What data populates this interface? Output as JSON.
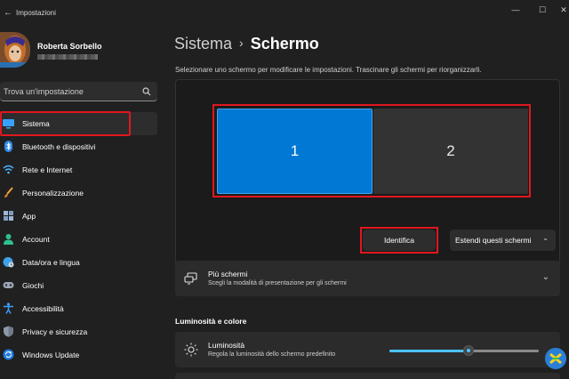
{
  "window": {
    "app_title": "Impostazioni",
    "controls": {
      "minimize": "—",
      "maximize": "☐",
      "close": "✕"
    }
  },
  "user": {
    "name": "Roberta Sorbello"
  },
  "search": {
    "placeholder": "Trova un'impostazione",
    "icon": "search-icon"
  },
  "sidebar": {
    "items": [
      {
        "label": "Sistema",
        "icon": "system-icon",
        "active": true
      },
      {
        "label": "Bluetooth e dispositivi",
        "icon": "bluetooth-icon"
      },
      {
        "label": "Rete e Internet",
        "icon": "wifi-icon"
      },
      {
        "label": "Personalizzazione",
        "icon": "brush-icon"
      },
      {
        "label": "App",
        "icon": "apps-icon"
      },
      {
        "label": "Account",
        "icon": "person-icon"
      },
      {
        "label": "Data/ora e lingua",
        "icon": "globe-clock-icon"
      },
      {
        "label": "Giochi",
        "icon": "gamepad-icon"
      },
      {
        "label": "Accessibilità",
        "icon": "accessibility-icon"
      },
      {
        "label": "Privacy e sicurezza",
        "icon": "shield-icon"
      },
      {
        "label": "Windows Update",
        "icon": "update-icon"
      }
    ]
  },
  "main": {
    "breadcrumb": {
      "parent": "Sistema",
      "separator": "›",
      "current": "Schermo"
    },
    "hint": "Selezionare uno schermo per modificare le impostazioni. Trascinare gli schermi per riorganizzarli.",
    "monitors": [
      {
        "label": "1",
        "selected": true
      },
      {
        "label": "2",
        "selected": false
      }
    ],
    "identify_label": "Identifica",
    "extend_label": "Estendi questi schermi",
    "multi_screen": {
      "title": "Più schermi",
      "subtitle": "Scegli la modalità di presentazione per gli schermi"
    },
    "brightness_section": "Luminosità e colore",
    "brightness": {
      "title": "Luminosità",
      "subtitle": "Regola la luminosità dello schermo predefinito",
      "value_fraction": 0.53
    }
  },
  "colors": {
    "accent": "#0078d4",
    "highlight_red": "#e0171f",
    "slider_fill": "#4cc2ff",
    "background": "#202020"
  }
}
